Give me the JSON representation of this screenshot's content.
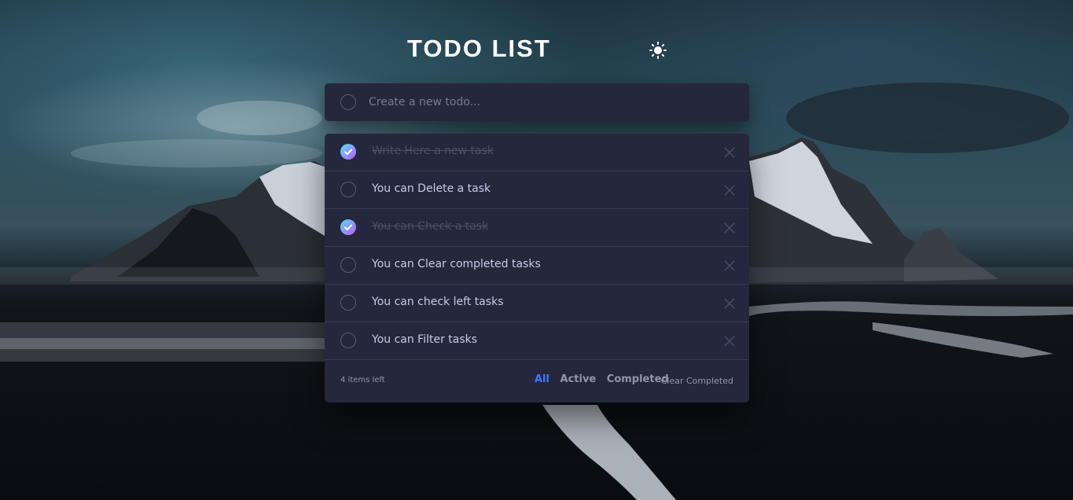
{
  "header": {
    "title": "TODO LIST",
    "theme_icon": "sun-icon"
  },
  "new_todo": {
    "placeholder": "Create a new todo..."
  },
  "todos": [
    {
      "text": "Write Here a new task",
      "completed": true
    },
    {
      "text": "You can Delete a task",
      "completed": false
    },
    {
      "text": "You can Check a task",
      "completed": true
    },
    {
      "text": "You can Clear completed tasks",
      "completed": false
    },
    {
      "text": "You can check left tasks",
      "completed": false
    },
    {
      "text": "You can Filter tasks",
      "completed": false
    }
  ],
  "footer": {
    "items_left": "4 items left",
    "filter_all": "All",
    "filter_active": "Active",
    "filter_completed": "Completed",
    "clear_completed": "Clear Completed"
  },
  "colors": {
    "panel": "#25273d",
    "accent": "#3a7cfd",
    "check_gradient_start": "#57ddff",
    "check_gradient_end": "#c058f3"
  }
}
